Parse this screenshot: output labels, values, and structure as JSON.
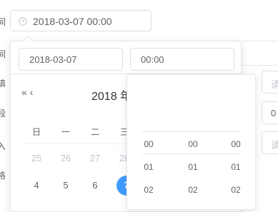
{
  "form": {
    "side_labels": [
      "间",
      "间",
      "填",
      "段",
      "入",
      "格"
    ],
    "datetime_value": "2018-03-07 00:00"
  },
  "picker": {
    "date_input": "2018-03-07",
    "time_input": "00:00",
    "nav": "« ‹",
    "header_title": "2018 年",
    "weekdays": [
      "日",
      "一",
      "二",
      "三"
    ],
    "week1": [
      "25",
      "26",
      "27",
      "28"
    ],
    "week2": [
      "4",
      "5",
      "6",
      "7"
    ],
    "selected_day": "7"
  },
  "time_panel": {
    "hours": [
      "00",
      "01",
      "02"
    ],
    "minutes": [
      "00",
      "01",
      "02"
    ],
    "seconds": [
      "00",
      "01",
      "02"
    ]
  },
  "right_fields": {
    "placeholder_glyph": "请",
    "value_glyph": "0"
  },
  "colors": {
    "accent": "#409eff",
    "border": "#dcdfe6",
    "text": "#606266",
    "muted": "#c0c4cc"
  }
}
